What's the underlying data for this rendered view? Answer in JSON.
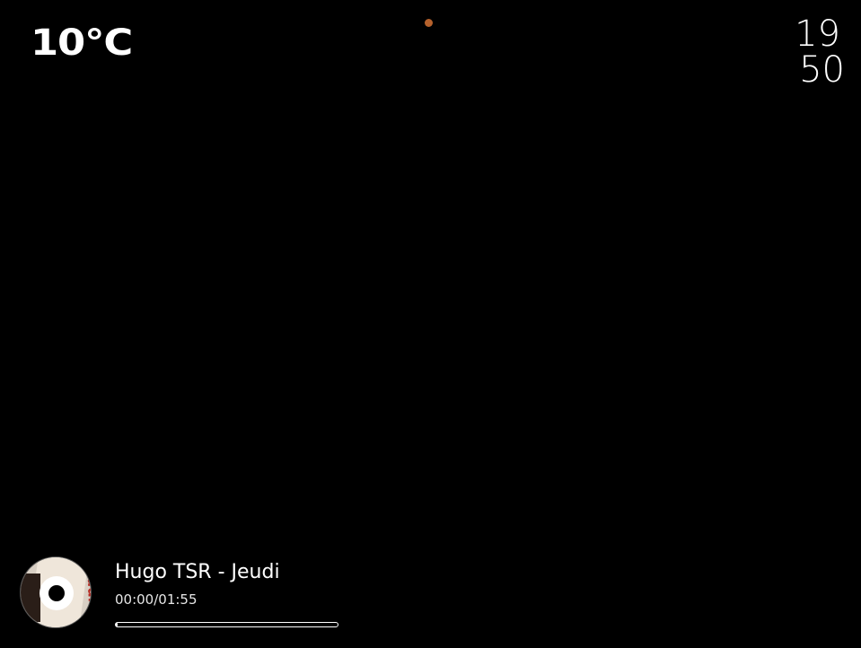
{
  "weather": {
    "temperature": "10°C"
  },
  "status": {
    "dot_color": "#b5612c"
  },
  "clock": {
    "hours": "19",
    "minutes": "50"
  },
  "player": {
    "title": "Hugo TSR - Jeudi",
    "time": "00:00/01:55",
    "progress": 0.01
  }
}
